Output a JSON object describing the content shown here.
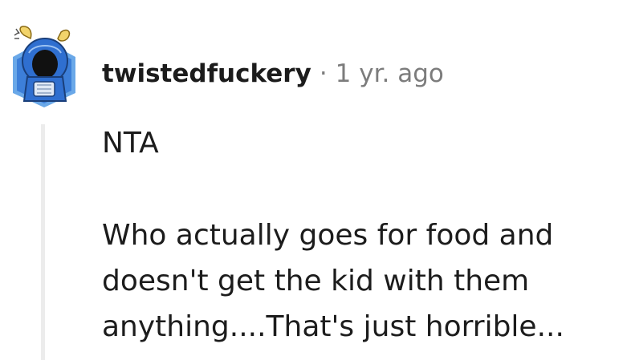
{
  "comment": {
    "author": "twistedfuckery",
    "separator": "·",
    "timestamp": "1 yr. ago",
    "paragraphs": [
      "NTA",
      "Who actually goes for food and doesn't get the kid with them anything....That's just horrible..."
    ],
    "avatar_icon": "snoo-avatar-icon",
    "colors": {
      "text": "#1c1c1c",
      "meta": "#7c7c7c",
      "thread_line": "#ececec",
      "avatar_blue": "#2f6fd0",
      "avatar_horns": "#f2d46b"
    }
  }
}
